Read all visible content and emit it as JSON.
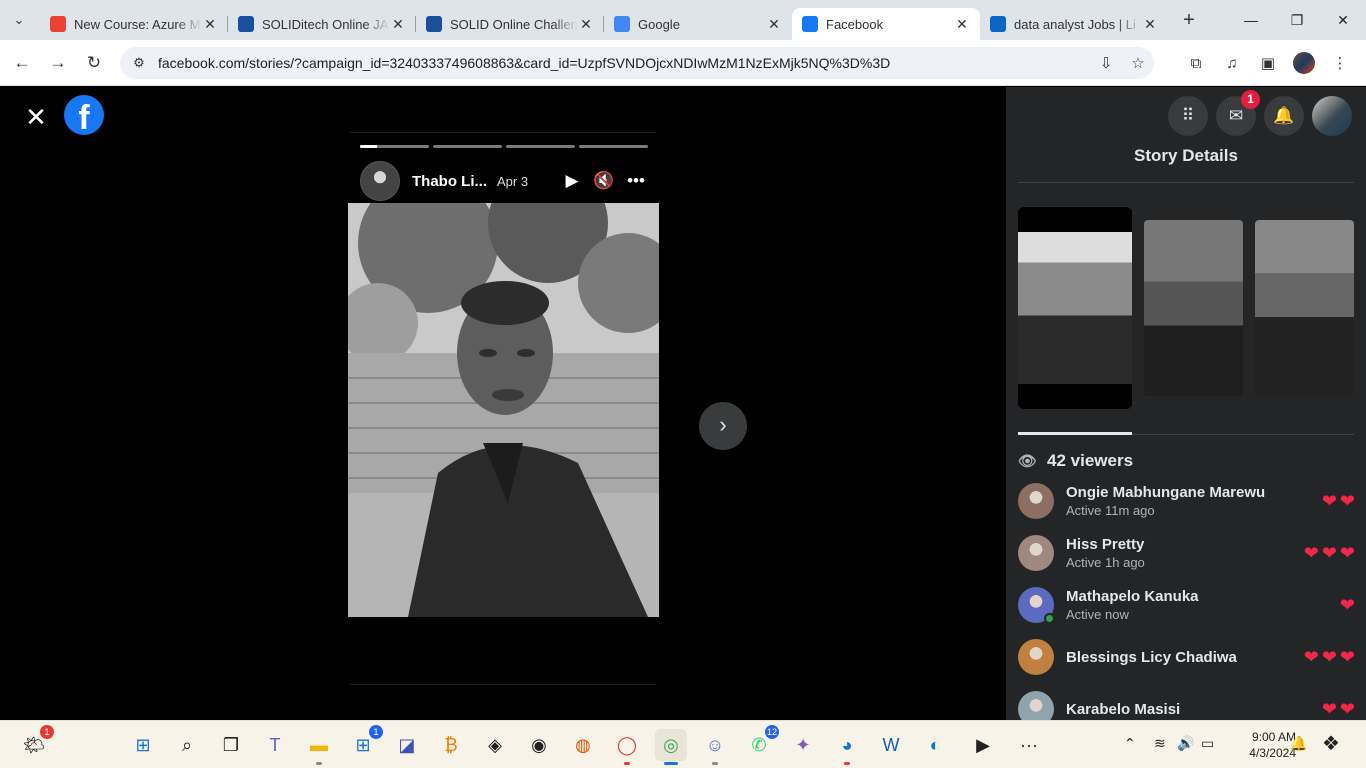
{
  "browser": {
    "tabs": [
      {
        "title": "New Course: Azure M",
        "icon": "gmail-icon",
        "color": "#ea4335"
      },
      {
        "title": "SOLIDitech Online JA",
        "icon": "solid-icon",
        "color": "#1a4fa0"
      },
      {
        "title": "SOLID Online Challen",
        "icon": "solid-icon",
        "color": "#1a4fa0"
      },
      {
        "title": "Google",
        "icon": "google-icon",
        "color": "#4285f4"
      },
      {
        "title": "Facebook",
        "icon": "facebook-icon",
        "color": "#1877f2",
        "active": true
      },
      {
        "title": "data analyst Jobs | Li",
        "icon": "linkedin-icon",
        "color": "#0a66c2"
      }
    ],
    "url": "facebook.com/stories/?campaign_id=3240333749608863&card_id=UzpfSVNDOjcxNDIwMzM1NzExMjk5NQ%3D%3D"
  },
  "story": {
    "author": "Thabo Li...",
    "date": "Apr 3",
    "progress": [
      0.25,
      0,
      0,
      0
    ]
  },
  "panel": {
    "title": "Story Details",
    "messenger_badge": "1",
    "viewers_label": "42 viewers",
    "viewers": [
      {
        "name": "Ongie Mabhungane Marewu",
        "status": "Active 11m ago",
        "hearts": 2,
        "color": "#8d6e63"
      },
      {
        "name": "Hiss Pretty",
        "status": "Active 1h ago",
        "hearts": 3,
        "color": "#a1887f"
      },
      {
        "name": "Mathapelo Kanuka",
        "status": "Active now",
        "hearts": 1,
        "color": "#5c6bc0",
        "online": true
      },
      {
        "name": "Blessings Licy Chadiwa",
        "status": "",
        "hearts": 3,
        "color": "#bf8040"
      },
      {
        "name": "Karabelo Masisi",
        "status": "",
        "hearts": 2,
        "color": "#90a4ae"
      }
    ]
  },
  "taskbar": {
    "time": "9:00 AM",
    "date": "4/3/2024",
    "weather_badge": "1",
    "store_badge": "1",
    "whatsapp_badge": "12"
  }
}
